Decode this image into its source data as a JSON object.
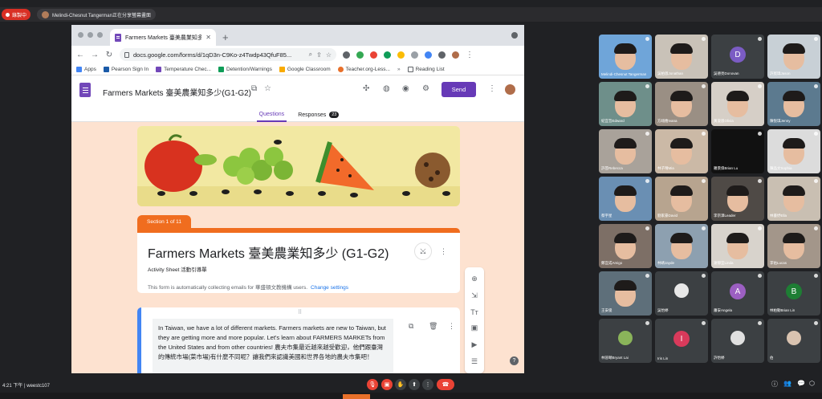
{
  "meet": {
    "recording_label": "錄製中",
    "presenter_label": "Melindi-Chesnut Tangerman正在分享螢幕畫面",
    "clock": "4:21 下午",
    "meeting_code": "weestc107"
  },
  "browser": {
    "tab_title": "Farmers Markets 臺美農業知多少",
    "url": "docs.google.com/forms/d/1qD3n-C9Ko-z4Twdp43QfuF85...",
    "bookmarks": [
      "Apps",
      "Pearson Sign In",
      "Temperature Chec...",
      "Detention/Warnings",
      "Google Classroom",
      "Teacher.org-Less..."
    ],
    "reading_list": "Reading List"
  },
  "forms": {
    "doc_title": "Farmers Markets 臺美農業知多少(G1-G2)",
    "send_label": "Send",
    "tab_questions": "Questions",
    "tab_responses": "Responses",
    "responses_count": "23",
    "section_label": "Section 1 of 11",
    "form_title": "Farmers Markets 臺美農業知多少 (G1-G2)",
    "form_description": "Activity Sheet 活動引導單",
    "email_note": "This form is automatically collecting emails for 華盛頓文教機構 users.",
    "change_settings": "Change settings",
    "text_block": "In Taiwan, we have a lot of different markets. Farmers markets are new to Taiwan, but they are getting more and more popular. Let's learn about FARMERS MARKETs from the United States and from other countries! 農夫市集最近越來越受歡迎，他們跟臺灣的傳統市場(菜市場)有什麼不同呢？讓我們來認識美國和世界各地的農夫市集吧！"
  },
  "participants": [
    {
      "name": "Melindi-Chesnut Tangerman",
      "kind": "person",
      "color": "#6fa5d9"
    },
    {
      "name": "吳柏恩Jonathan",
      "kind": "person",
      "color": "#c9c2b8"
    },
    {
      "name": "吳德亮Donovan",
      "kind": "letter",
      "letter": "D",
      "color": "#7b5cc4"
    },
    {
      "name": "許宸瑋Jason",
      "kind": "person",
      "color": "#c8d0d6"
    },
    {
      "name": "紀宜哲Edward",
      "kind": "person",
      "color": "#6e8f8a"
    },
    {
      "name": "方翊喬Ivana",
      "kind": "person",
      "color": "#9a8f84"
    },
    {
      "name": "黃浚恩Olivia",
      "kind": "person",
      "color": "#d6cfc7"
    },
    {
      "name": "陳悅琪Jenny",
      "kind": "person",
      "color": "#5c7a8f"
    },
    {
      "name": "許芸Rebecca",
      "kind": "person",
      "color": "#a9a29a"
    },
    {
      "name": "林子晴Mia",
      "kind": "person",
      "color": "#cbb9a6"
    },
    {
      "name": "羅景偉Brian Lu",
      "kind": "dark",
      "color": "#111111"
    },
    {
      "name": "陳品文Sophia",
      "kind": "person",
      "color": "#dcdcdc"
    },
    {
      "name": "蔡宇星",
      "kind": "person",
      "color": "#6a8fb3"
    },
    {
      "name": "劉家豪David",
      "kind": "person",
      "color": "#b7a48f"
    },
    {
      "name": "李宗澤Leader",
      "kind": "person",
      "color": "#4f4a46"
    },
    {
      "name": "林書妤Ella",
      "kind": "person",
      "color": "#c9bfb2"
    },
    {
      "name": "鄭宜成Amigo",
      "kind": "person",
      "color": "#7d6f66"
    },
    {
      "name": "林靖Jayde",
      "kind": "person",
      "color": "#8da0b0"
    },
    {
      "name": "謝靜宜Linda",
      "kind": "person",
      "color": "#d8d3cc"
    },
    {
      "name": "李佑Lucas",
      "kind": "person",
      "color": "#a3968a"
    },
    {
      "name": "王安俊",
      "kind": "person",
      "color": "#5e6f7a"
    },
    {
      "name": "吳怡婷",
      "kind": "photo",
      "color": "#e8e8e8"
    },
    {
      "name": "蕭安Angela",
      "kind": "letter",
      "letter": "A",
      "color": "#9c5fc2"
    },
    {
      "name": "林柏勳Brian Lin",
      "kind": "letter",
      "letter": "B",
      "color": "#1e7e34"
    },
    {
      "name": "林晉頤Bryant Lai",
      "kind": "photo",
      "color": "#8ab45a"
    },
    {
      "name": "Iris Lin",
      "kind": "letter",
      "letter": "I",
      "color": "#d93a5b"
    },
    {
      "name": "許怡婷",
      "kind": "photo",
      "color": "#e0e0e0"
    },
    {
      "name": "伯",
      "kind": "photo",
      "color": "#d9c3b0"
    }
  ]
}
